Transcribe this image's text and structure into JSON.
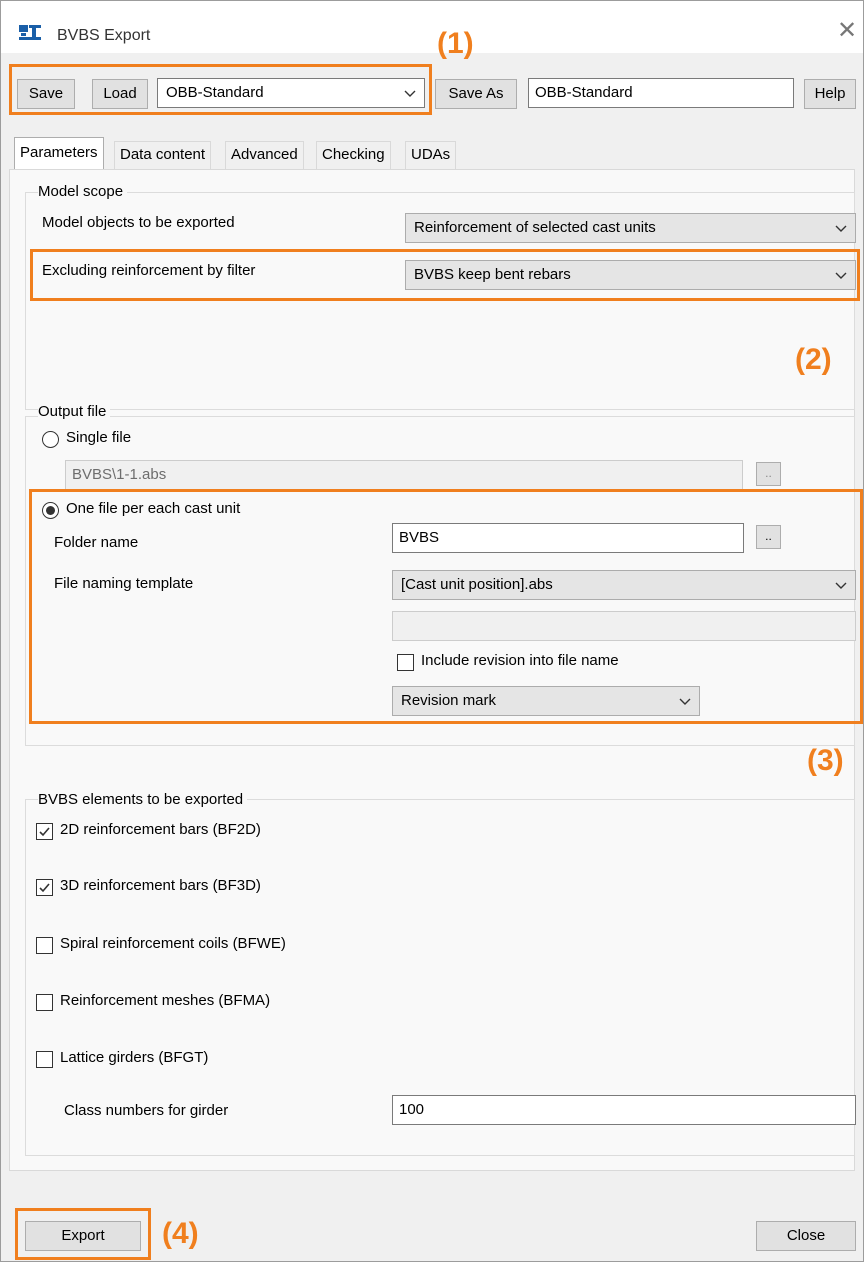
{
  "window": {
    "title": "BVBS Export",
    "icon": "app-logo-icon",
    "close_icon": "close-icon"
  },
  "toolbar": {
    "save_label": "Save",
    "load_label": "Load",
    "preset_value": "OBB-Standard",
    "save_as_label": "Save As",
    "save_as_value": "OBB-Standard",
    "help_label": "Help"
  },
  "tabs": [
    {
      "label": "Parameters",
      "active": true
    },
    {
      "label": "Data content"
    },
    {
      "label": "Advanced"
    },
    {
      "label": "Checking"
    },
    {
      "label": "UDAs"
    }
  ],
  "model_scope": {
    "group_label": "Model scope",
    "objects_label": "Model objects to be exported",
    "objects_value": "Reinforcement of selected cast units",
    "filter_label": "Excluding reinforcement by filter",
    "filter_value": "BVBS keep bent rebars"
  },
  "output_file": {
    "group_label": "Output file",
    "single_label": "Single file",
    "single_value": "BVBS\\1-1.abs",
    "per_unit_label": "One file per each cast unit",
    "folder_label": "Folder name",
    "folder_value": "BVBS",
    "browse_label": "..",
    "naming_label": "File naming template",
    "naming_value": "[Cast unit position].abs",
    "naming_extra_value": "",
    "include_revision_label": "Include revision into file name",
    "include_revision_checked": false,
    "revision_value": "Revision mark"
  },
  "elements": {
    "group_label": "BVBS elements to be exported",
    "items": [
      {
        "label": "2D reinforcement bars (BF2D)",
        "checked": true
      },
      {
        "label": "3D reinforcement bars (BF3D)",
        "checked": true
      },
      {
        "label": "Spiral reinforcement coils (BFWE)",
        "checked": false
      },
      {
        "label": "Reinforcement meshes (BFMA)",
        "checked": false
      },
      {
        "label": "Lattice girders (BFGT)",
        "checked": false
      }
    ],
    "class_numbers_label": "Class numbers for girder",
    "class_numbers_value": "100"
  },
  "footer": {
    "export_label": "Export",
    "close_label": "Close"
  },
  "callouts": [
    "(1)",
    "(2)",
    "(3)",
    "(4)"
  ],
  "colors": {
    "highlight": "#f07f1e",
    "window_bg": "#f0f0f0",
    "panel_bg": "#f9f9f9"
  }
}
